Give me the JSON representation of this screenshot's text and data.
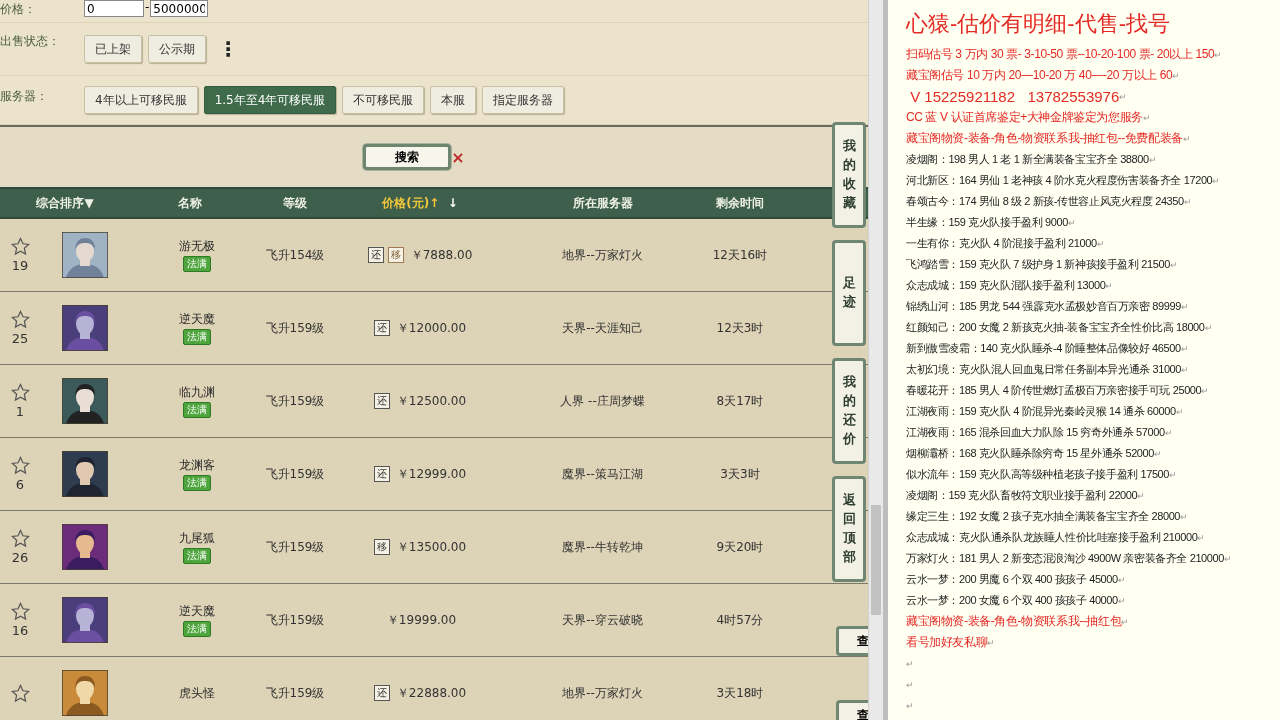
{
  "filters": {
    "price": {
      "label": "价格：",
      "min": "0",
      "separator": "-",
      "max": "5000000"
    },
    "status": {
      "label": "出售状态：",
      "options": [
        {
          "label": "已上架",
          "selected": false
        },
        {
          "label": "公示期",
          "selected": false
        }
      ],
      "more": "⋮"
    },
    "server": {
      "label": "服务器：",
      "options": [
        {
          "label": "4年以上可移民服",
          "selected": false
        },
        {
          "label": "1.5年至4年可移民服",
          "selected": true
        },
        {
          "label": "不可移民服",
          "selected": false
        },
        {
          "label": "本服",
          "selected": false
        },
        {
          "label": "指定服务器",
          "selected": false
        }
      ]
    }
  },
  "search": {
    "button": "搜索",
    "clear": "×"
  },
  "table": {
    "columns": [
      {
        "label": "综合排序",
        "sort": "▼",
        "active": false
      },
      {
        "label": "名称",
        "active": false
      },
      {
        "label": "等级",
        "active": false
      },
      {
        "label": "价格(元)",
        "sort_up": "↑",
        "sort_down": "↓",
        "active": true
      },
      {
        "label": "所在服务器",
        "active": false
      },
      {
        "label": "剩余时间",
        "active": false
      }
    ],
    "rows": [
      {
        "count": "19",
        "name": "游无极",
        "badge": "法满",
        "level": "飞升154级",
        "tags": [
          "还",
          "移"
        ],
        "price": "￥7888.00",
        "server": "地界--万家灯火",
        "time": "12天16时"
      },
      {
        "count": "25",
        "name": "逆天魔",
        "badge": "法满",
        "level": "飞升159级",
        "tags": [
          "还"
        ],
        "price": "￥12000.00",
        "server": "天界--天涯知己",
        "time": "12天3时"
      },
      {
        "count": "1",
        "name": "临九渊",
        "badge": "法满",
        "level": "飞升159级",
        "tags": [
          "还"
        ],
        "price": "￥12500.00",
        "server": "人界 --庄周梦蝶",
        "time": "8天17时"
      },
      {
        "count": "6",
        "name": "龙渊客",
        "badge": "法满",
        "level": "飞升159级",
        "tags": [
          "还"
        ],
        "price": "￥12999.00",
        "server": "魔界--策马江湖",
        "time": "3天3时"
      },
      {
        "count": "26",
        "name": "九尾狐",
        "badge": "法满",
        "level": "飞升159级",
        "tags": [
          "移"
        ],
        "price": "￥13500.00",
        "server": "魔界--牛转乾坤",
        "time": "9天20时"
      },
      {
        "count": "16",
        "name": "逆天魔",
        "badge": "法满",
        "level": "飞升159级",
        "tags": [],
        "price": "￥19999.00",
        "server": "天界--穿云破晓",
        "time": "4时57分"
      },
      {
        "name": "虎头怪",
        "level": "飞升159级",
        "tags": [
          "还"
        ],
        "price": "￥22888.00",
        "server": "地界--万家灯火",
        "time": "3天18时"
      }
    ]
  },
  "side_tabs": [
    "我的收藏",
    "足迹",
    "我的还价",
    "返回顶部"
  ],
  "side_buttons": [
    "查",
    "查"
  ],
  "notes": {
    "lines": [
      {
        "kind": "title",
        "text": "心猿-估价有明细-代售-找号"
      },
      {
        "kind": "red",
        "text": "扫码估号 3 万内 30 票- 3-10-50 票--10-20-100 票- 20以上 150",
        "mark": "↵"
      },
      {
        "kind": "red",
        "text": "藏宝阁估号 10 万内 20—10-20 万 40—-20 万以上 60",
        "mark": "↵"
      },
      {
        "kind": "phone",
        "text": " V 15225921182   13782553976",
        "mark": "↵"
      },
      {
        "kind": "red",
        "text": "CC 蓝 V 认证首席鉴定+大神金牌鉴定为您服务",
        "mark": "↵"
      },
      {
        "kind": "red",
        "text": "藏宝阁物资-装备-角色-物资联系我-抽红包--免费配装备",
        "mark": "↵"
      },
      {
        "kind": "plain",
        "text": "凌烟阁：198 男人 1 老 1 新全满装备宝宝齐全 38800",
        "mark": "↵"
      },
      {
        "kind": "plain",
        "text": "河北新区：164 男仙 1 老神孩 4 阶水克火程度伤害装备齐全 17200",
        "mark": "↵"
      },
      {
        "kind": "plain",
        "text": "春颂古今：174 男仙 8 级 2 新孩-传世容止风克火程度 24350",
        "mark": "↵"
      },
      {
        "kind": "plain",
        "text": "半生缘：159 克火队接手盈利 9000",
        "mark": "↵"
      },
      {
        "kind": "plain",
        "text": "一生有你：克火队 4 阶混接手盈利 21000",
        "mark": "↵"
      },
      {
        "kind": "plain",
        "text": "飞鸿踏雪：159 克火队 7 级护身 1 新神孩接手盈利 21500",
        "mark": "↵"
      },
      {
        "kind": "plain",
        "text": "众志成城：159 克火队混队接手盈利 13000",
        "mark": "↵"
      },
      {
        "kind": "plain",
        "text": "锦绣山河：185 男龙 544 强霹克水孟极妙音百万亲密 89999",
        "mark": "↵"
      },
      {
        "kind": "plain",
        "text": "红颜知己：200 女魔 2 新孩克火抽-装备宝宝齐全性价比高 18000",
        "mark": "↵"
      },
      {
        "kind": "plain",
        "text": "新到傲雪凌霜：140 克火队睡杀-4 阶睡整体品像较好 46500",
        "mark": "↵"
      },
      {
        "kind": "plain",
        "text": "太初幻境：克火队混人回血鬼日常任务副本异光通杀 31000",
        "mark": "↵"
      },
      {
        "kind": "plain",
        "text": "春暖花开：185 男人 4 阶传世燃灯孟极百万亲密接手可玩 25000",
        "mark": "↵"
      },
      {
        "kind": "plain",
        "text": "江湖夜雨：159 克火队 4 阶混异光秦岭灵猴 14 通杀 60000",
        "mark": "↵"
      },
      {
        "kind": "plain",
        "text": "江湖夜雨：165 混杀回血大力队除 15 穷奇外通杀 57000",
        "mark": "↵"
      },
      {
        "kind": "plain",
        "text": "烟柳灞桥：168 克火队睡杀除穷奇 15 星外通杀 52000",
        "mark": "↵"
      },
      {
        "kind": "plain",
        "text": "似水流年：159 克火队高等级种植老孩子接手盈利 17500",
        "mark": "↵"
      },
      {
        "kind": "plain",
        "text": "凌烟阁：159 克火队畜牧符文职业接手盈利 22000",
        "mark": "↵"
      },
      {
        "kind": "plain",
        "text": "缘定三生：192 女魔 2 孩子克水抽全满装备宝宝齐全 28000",
        "mark": "↵"
      },
      {
        "kind": "plain",
        "text": "众志成城：克火队通杀队龙族睡人性价比哇塞接手盈利 210000",
        "mark": "↵"
      },
      {
        "kind": "plain",
        "text": "万家灯火：181 男人 2 新变态混浪淘沙 4900W 亲密装备齐全 210000",
        "mark": "↵"
      },
      {
        "kind": "plain",
        "text": "云水一梦：200 男魔 6 个双 400 孩孩子 45000",
        "mark": "↵"
      },
      {
        "kind": "plain",
        "text": "云水一梦：200 女魔 6 个双 400 孩孩子 40000",
        "mark": "↵"
      },
      {
        "kind": "red",
        "text": "藏宝阁物资-装备-角色-物资联系我--抽红包",
        "mark": "↵"
      },
      {
        "kind": "red",
        "text": "看号加好友私聊",
        "mark": "↵"
      },
      {
        "kind": "blank",
        "mark": "↵"
      },
      {
        "kind": "blank",
        "mark": "↵"
      },
      {
        "kind": "blank",
        "mark": "↵"
      }
    ]
  }
}
